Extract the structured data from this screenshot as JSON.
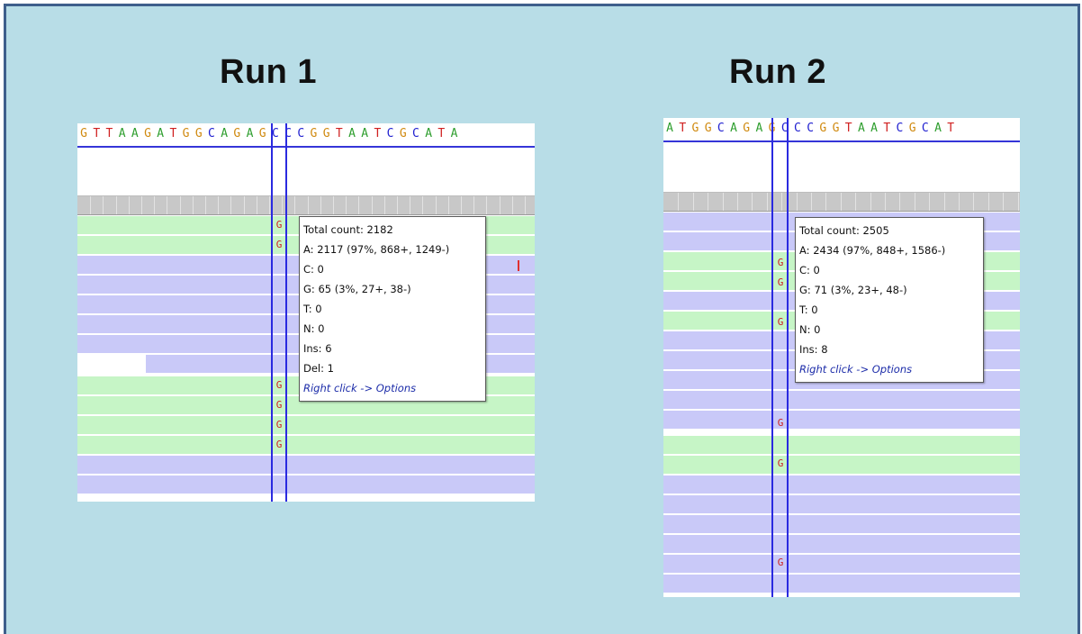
{
  "runs": [
    {
      "title": "Run 1",
      "sequence": "GTTAAGATGGCAGAGCCCGGTAATCGCATA",
      "tooltip": {
        "total": "Total count: 2182",
        "a": "A: 2117 (97%, 868+, 1249-)",
        "c": "C: 0",
        "g": "G: 65 (3%, 27+, 38-)",
        "t": "T: 0",
        "n": "N: 0",
        "ins": "Ins: 6",
        "del": "Del: 1",
        "hint": "Right click -> Options"
      },
      "mismatch_base": "G"
    },
    {
      "title": "Run 2",
      "sequence": "ATGGCAGAGCCCGGTAATCGCAT",
      "tooltip": {
        "total": "Total count: 2505",
        "a": "A: 2434 (97%, 848+, 1586-)",
        "c": "C: 0",
        "g": "G: 71 (3%, 23+, 48-)",
        "t": "T: 0",
        "n": "N: 0",
        "ins": "Ins: 8",
        "hint": "Right click -> Options"
      },
      "mismatch_base": "G"
    }
  ],
  "colors": {
    "A": "#2e9e2e",
    "C": "#2020d0",
    "G": "#d08a10",
    "T": "#d02020",
    "forward_read": "#c6f5c6",
    "reverse_read": "#c9c9f8",
    "background": "#b8dde7"
  }
}
